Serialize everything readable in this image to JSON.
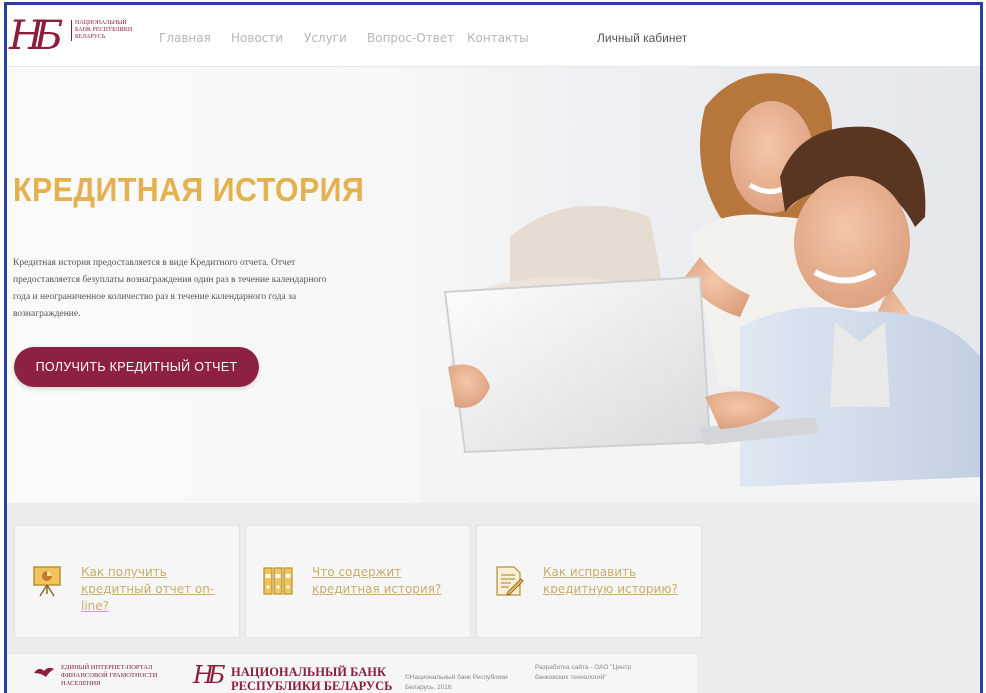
{
  "header": {
    "logo_text": "Национальный банк Республики Беларусь",
    "logo_monogram": "НБ",
    "nav": [
      {
        "label": "Главная"
      },
      {
        "label": "Новости"
      },
      {
        "label": "Услуги"
      },
      {
        "label": "Вопрос-Ответ"
      },
      {
        "label": "Контакты"
      }
    ],
    "cabinet_label": "Личный кабинет"
  },
  "hero": {
    "title": "КРЕДИТНАЯ ИСТОРИЯ",
    "description": "Кредитная история предоставляется в виде Кредитного отчета. Отчет предоставляется безуплаты вознаграждения один раз в течение календарного года и неограниченное количество раз в течение календарного года за вознаграждение.",
    "button_label": "ПОЛУЧИТЬ КРЕДИТНЫЙ ОТЧЕТ"
  },
  "cards": [
    {
      "label": "Как получить кредитный отчет on-line?",
      "icon": "presentation-board-icon"
    },
    {
      "label": "Что содержит кредитная история?",
      "icon": "binders-icon"
    },
    {
      "label": "Как исправить кредитную историю?",
      "icon": "edit-document-icon"
    }
  ],
  "footer": {
    "portal_text": "Единый интернет-портал финансовой грамотности населения",
    "bank_line1": "НАЦИОНАЛЬНЫЙ БАНК",
    "bank_line2": "РЕСПУБЛИКИ БЕЛАРУСЬ",
    "copyright": "©Национальный банк Республики Беларусь, 2016",
    "developer": "Разработка сайта - ОАО \"Центр банковских технологий\""
  },
  "colors": {
    "frame": "#2b3f9e",
    "accent": "#8e2140",
    "title_gold": "#e3b14d",
    "link_gold": "#c9ad6b"
  }
}
